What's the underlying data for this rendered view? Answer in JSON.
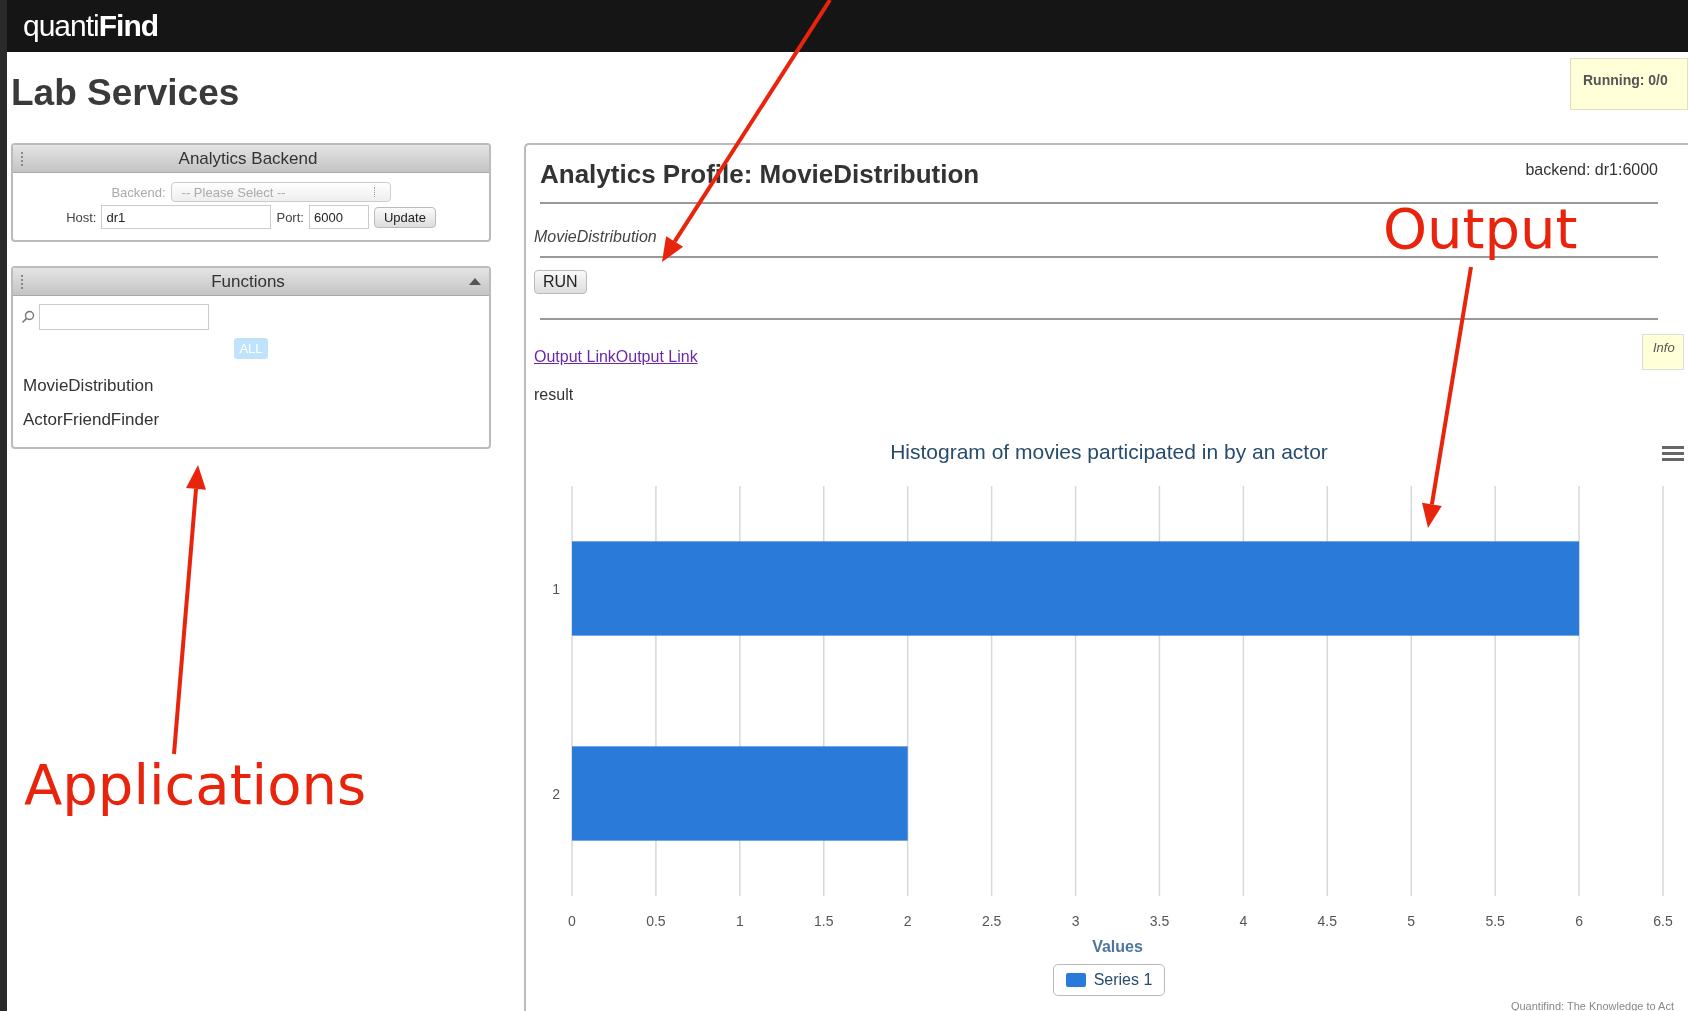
{
  "app": {
    "logo_light": "quanti",
    "logo_bold": "Find"
  },
  "page_title": "Lab Services",
  "running_badge": "Running: 0/0",
  "backend_panel": {
    "title": "Analytics Backend",
    "backend_label": "Backend:",
    "backend_select": "-- Please Select --",
    "backend_disabled": true,
    "host_label": "Host:",
    "host_value": "dr1",
    "port_label": "Port:",
    "port_value": "6000",
    "update_button": "Update"
  },
  "functions_panel": {
    "title": "Functions",
    "expanded": true,
    "filter_button": {
      "label": "ALL",
      "selected": true
    },
    "items": [
      {
        "label": "MovieDistribution",
        "selected": false
      },
      {
        "label": "ActorFriendFinder",
        "selected": false
      }
    ]
  },
  "profile": {
    "title": "Analytics Profile: MovieDistribution",
    "backend": "backend: dr1:6000",
    "function_name": "MovieDistribution",
    "run_button": "RUN",
    "output_link": "Output LinkOutput Link",
    "info": "Info",
    "result_label": "result",
    "chart_data": {
      "type": "bar",
      "orientation": "horizontal",
      "title": "Histogram of movies participated in by an actor",
      "xlabel": "Values",
      "categories": [
        "1",
        "2"
      ],
      "series": [
        {
          "name": "Series 1",
          "color": "#2a7ad9",
          "values": [
            6,
            2
          ]
        }
      ],
      "grid": true,
      "xlim": [
        0,
        6.5
      ],
      "xticks": [
        0,
        0.5,
        1,
        1.5,
        2,
        2.5,
        3,
        3.5,
        4,
        4.5,
        5,
        5.5,
        6,
        6.5
      ]
    },
    "credit": "Quantifind: The Knowledge to Act"
  },
  "annotations": [
    {
      "kind": "arrow"
    },
    {
      "kind": "label",
      "text": "Output"
    },
    {
      "kind": "arrow"
    },
    {
      "kind": "label",
      "text": "Applications"
    },
    {
      "kind": "arrow"
    }
  ]
}
